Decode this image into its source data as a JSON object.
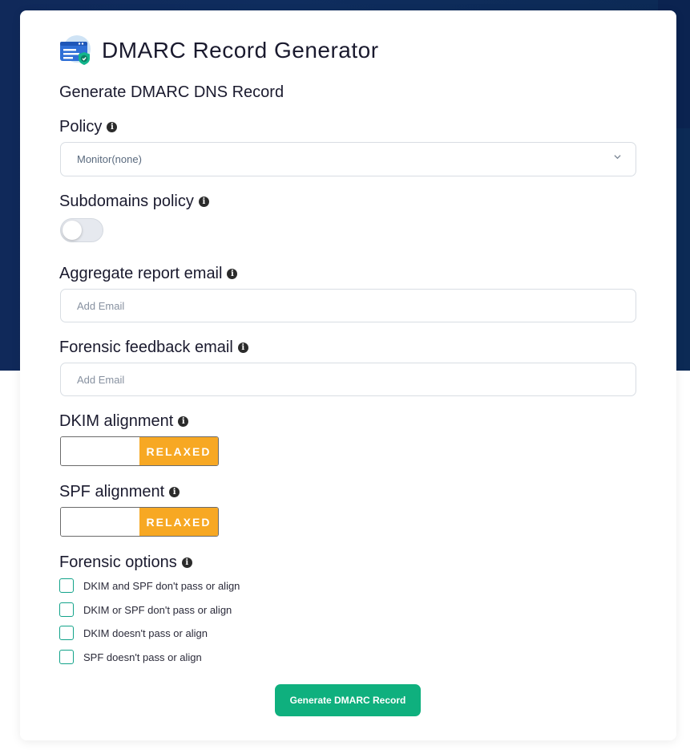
{
  "app": {
    "title": "DMARC Record Generator",
    "subtitle": "Generate DMARC DNS Record"
  },
  "policy": {
    "label": "Policy",
    "selected": "Monitor(none)"
  },
  "subdomains": {
    "label": "Subdomains policy",
    "enabled": false
  },
  "aggregate": {
    "label": "Aggregate report email",
    "placeholder": "Add Email"
  },
  "forensic_email": {
    "label": "Forensic feedback email",
    "placeholder": "Add Email"
  },
  "dkim": {
    "label": "DKIM alignment",
    "selected": "RELAXED"
  },
  "spf": {
    "label": "SPF alignment",
    "selected": "RELAXED"
  },
  "forensic_options": {
    "label": "Forensic options",
    "items": [
      {
        "label": "DKIM and SPF don't pass or align",
        "checked": false
      },
      {
        "label": "DKIM or SPF don't pass or align",
        "checked": false
      },
      {
        "label": "DKIM doesn't pass or align",
        "checked": false
      },
      {
        "label": "SPF doesn't pass or align",
        "checked": false
      }
    ]
  },
  "generate_button": "Generate DMARC Record",
  "colors": {
    "accent": "#0fb07e",
    "relaxed": "#f7a823",
    "background": "#0d2a55",
    "checkbox": "#12a38a"
  }
}
